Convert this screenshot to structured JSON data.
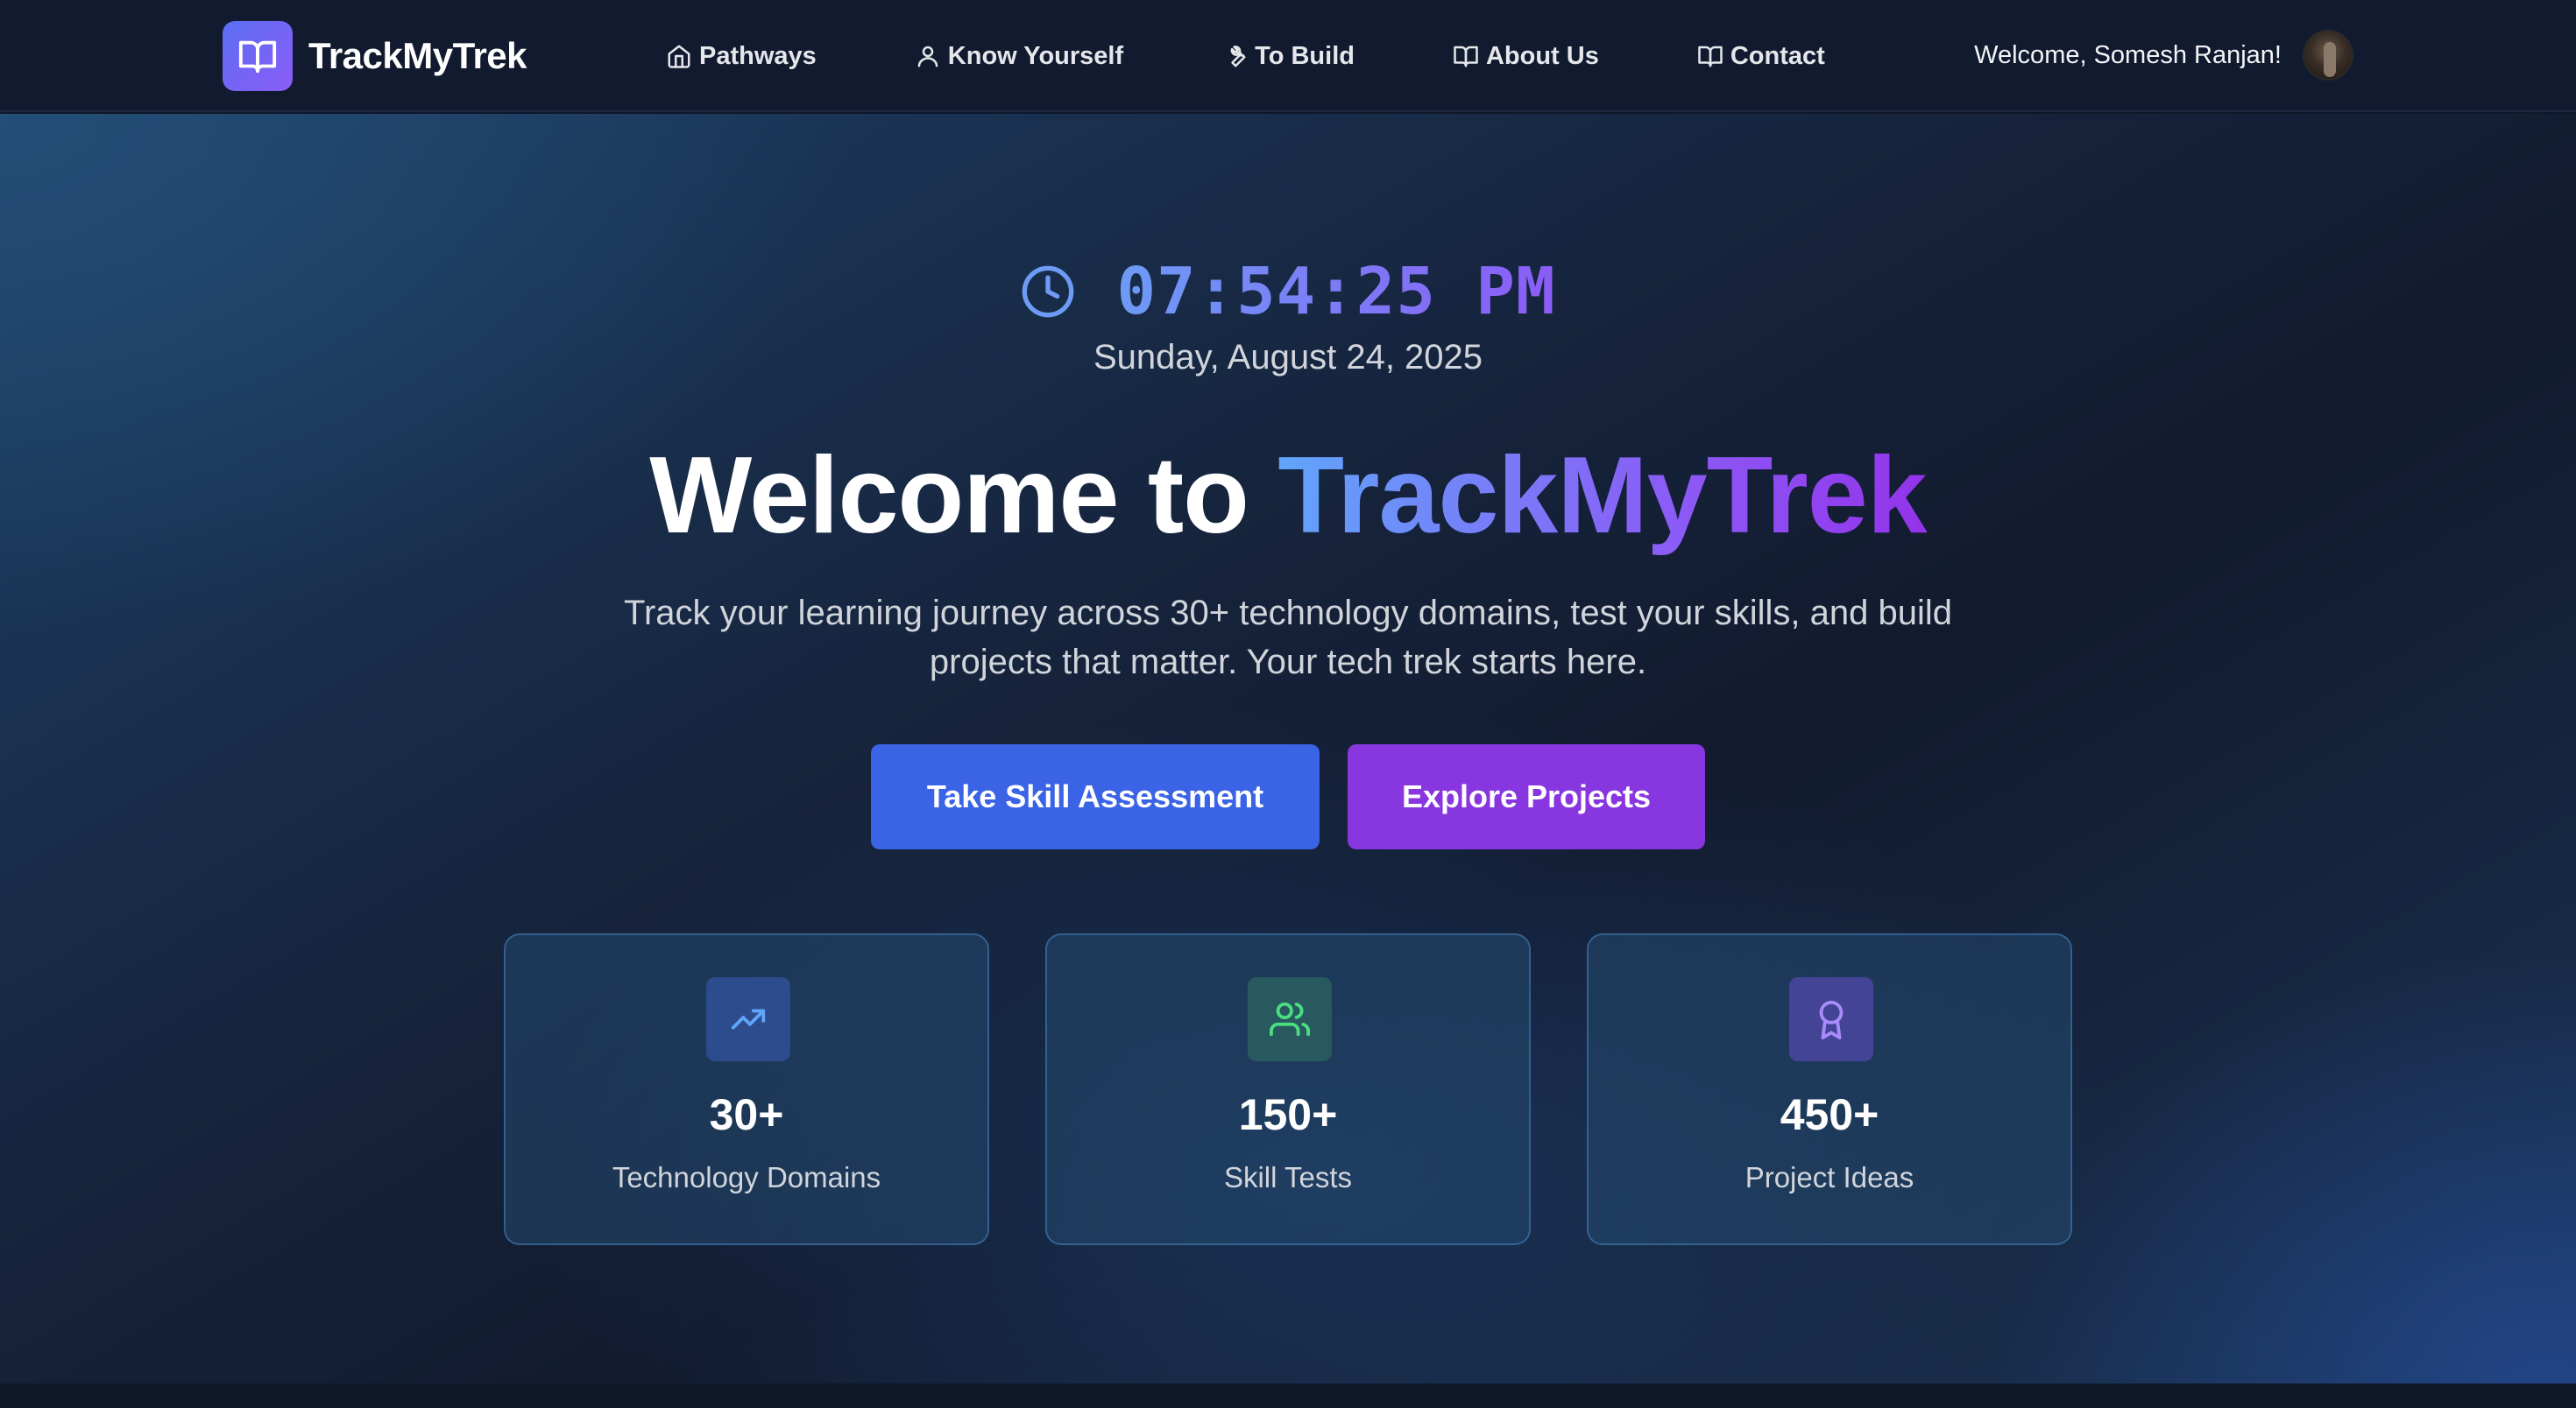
{
  "brand": {
    "name": "TrackMyTrek",
    "logo_icon": "open-book-icon"
  },
  "nav": {
    "items": [
      {
        "label": "Pathways",
        "icon": "home-icon"
      },
      {
        "label": "Know Yourself",
        "icon": "user-icon"
      },
      {
        "label": "To Build",
        "icon": "wrench-icon"
      },
      {
        "label": "About Us",
        "icon": "book-icon"
      },
      {
        "label": "Contact",
        "icon": "book-icon"
      }
    ]
  },
  "user": {
    "welcome": "Welcome, Somesh Ranjan!"
  },
  "clock": {
    "time": "07:54:25 PM",
    "date": "Sunday, August 24, 2025",
    "icon": "clock-icon"
  },
  "hero": {
    "title_prefix": "Welcome to ",
    "title_accent": "TrackMyTrek",
    "subtitle": "Track your learning journey across 30+ technology domains, test your skills, and build projects that matter. Your tech trek starts here."
  },
  "cta": {
    "primary_label": "Take Skill Assessment",
    "secondary_label": "Explore Projects"
  },
  "stats": [
    {
      "value": "30+",
      "label": "Technology Domains",
      "icon": "trending-up-icon",
      "color": "#60a5fa"
    },
    {
      "value": "150+",
      "label": "Skill Tests",
      "icon": "users-icon",
      "color": "#4ade80"
    },
    {
      "value": "450+",
      "label": "Project Ideas",
      "icon": "award-icon",
      "color": "#a78bfa"
    }
  ],
  "colors": {
    "nav_bg": "#111a2e",
    "primary_button": "#3b63e6",
    "secondary_button": "#8837e0",
    "brand_gradient_start": "#5b6ef5",
    "brand_gradient_end": "#8b5cf6"
  }
}
